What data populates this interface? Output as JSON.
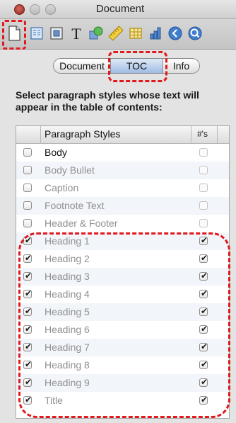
{
  "window": {
    "title": "Document"
  },
  "toolbar": {
    "tools": [
      {
        "name": "document-inspector-icon"
      },
      {
        "name": "layout-inspector-icon"
      },
      {
        "name": "wrap-inspector-icon"
      },
      {
        "name": "text-inspector-icon"
      },
      {
        "name": "graphic-inspector-icon"
      },
      {
        "name": "metrics-inspector-icon"
      },
      {
        "name": "table-inspector-icon"
      },
      {
        "name": "chart-inspector-icon"
      },
      {
        "name": "link-inspector-icon"
      },
      {
        "name": "quicktime-inspector-icon"
      }
    ]
  },
  "tabs": {
    "document": "Document",
    "toc": "TOC",
    "info": "Info",
    "selected": "TOC"
  },
  "instructions": "Select paragraph styles whose text will appear in the table of contents:",
  "table": {
    "header_styles": "Paragraph Styles",
    "header_nums": "#'s",
    "rows": [
      {
        "label": "Body",
        "checked": false,
        "page_numbers": false
      },
      {
        "label": "Body Bullet",
        "checked": false,
        "page_numbers": false
      },
      {
        "label": "Caption",
        "checked": false,
        "page_numbers": false
      },
      {
        "label": "Footnote Text",
        "checked": false,
        "page_numbers": false
      },
      {
        "label": "Header & Footer",
        "checked": false,
        "page_numbers": false
      },
      {
        "label": "Heading 1",
        "checked": true,
        "page_numbers": true
      },
      {
        "label": "Heading 2",
        "checked": true,
        "page_numbers": true
      },
      {
        "label": "Heading 3",
        "checked": true,
        "page_numbers": true
      },
      {
        "label": "Heading 4",
        "checked": true,
        "page_numbers": true
      },
      {
        "label": "Heading 5",
        "checked": true,
        "page_numbers": true
      },
      {
        "label": "Heading 6",
        "checked": true,
        "page_numbers": true
      },
      {
        "label": "Heading 7",
        "checked": true,
        "page_numbers": true
      },
      {
        "label": "Heading 8",
        "checked": true,
        "page_numbers": true
      },
      {
        "label": "Heading 9",
        "checked": true,
        "page_numbers": true
      },
      {
        "label": "Title",
        "checked": true,
        "page_numbers": true
      }
    ]
  },
  "colors": {
    "highlight": "#e0191c",
    "selected_tab": "#9fbbe4"
  }
}
